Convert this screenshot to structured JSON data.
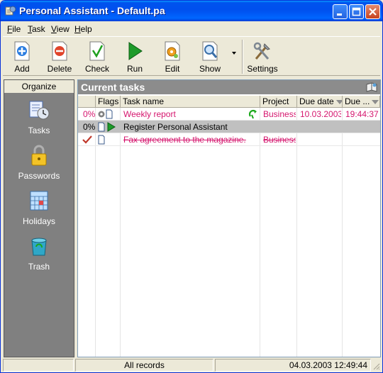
{
  "window": {
    "title": "Personal Assistant - Default.pa"
  },
  "menu": {
    "items": [
      {
        "label": "File",
        "accel": "F",
        "rest": "ile"
      },
      {
        "label": "Task",
        "accel": "T",
        "rest": "ask"
      },
      {
        "label": "View",
        "accel": "V",
        "rest": "iew"
      },
      {
        "label": "Help",
        "accel": "H",
        "rest": "elp"
      }
    ]
  },
  "toolbar": {
    "add": "Add",
    "delete": "Delete",
    "check": "Check",
    "run": "Run",
    "edit": "Edit",
    "show": "Show",
    "settings": "Settings"
  },
  "sidebar": {
    "header": "Organize",
    "items": [
      {
        "label": "Tasks",
        "icon": "tasks-icon"
      },
      {
        "label": "Passwords",
        "icon": "padlock-icon"
      },
      {
        "label": "Holidays",
        "icon": "calendar-icon"
      },
      {
        "label": "Trash",
        "icon": "trash-icon"
      }
    ]
  },
  "main": {
    "title": "Current tasks",
    "columns": [
      "Flags",
      "Task name",
      "Project",
      "Due date",
      "Due ..."
    ],
    "rows": [
      {
        "progress": "0%",
        "name": "Weekly report",
        "project": "Business",
        "due_date": "10.03.2003",
        "due_time": "19:44:37",
        "style": "pink"
      },
      {
        "progress": "0%",
        "name": "Register Personal Assistant",
        "project": "",
        "due_date": "",
        "due_time": "",
        "style": "selected"
      },
      {
        "progress": "",
        "name": "Fax agreement to the magazine.",
        "project": "Business",
        "due_date": "",
        "due_time": "",
        "style": "done"
      }
    ]
  },
  "status": {
    "records": "All records",
    "datetime": "04.03.2003 12:49:44"
  },
  "colors": {
    "title_bar": "#0053ee",
    "sidebar": "#808080",
    "overdue": "#d5166e",
    "selected_row": "#c0c0c0"
  }
}
